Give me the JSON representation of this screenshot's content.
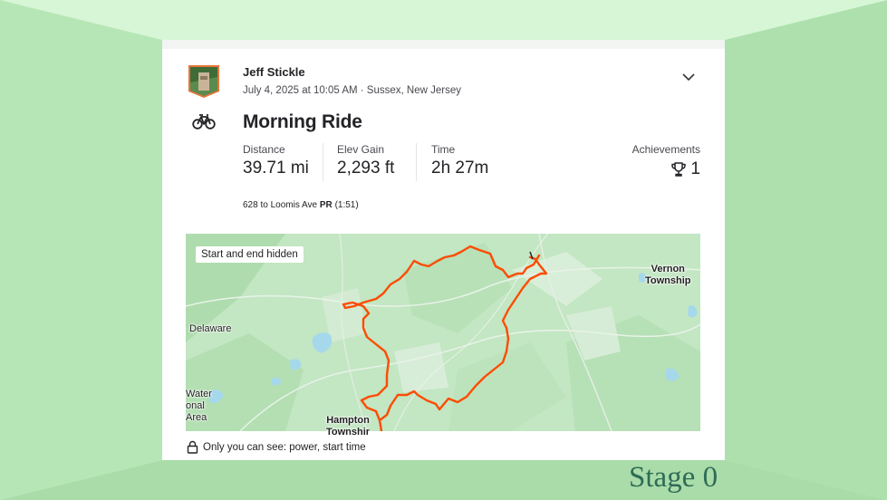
{
  "colors": {
    "stage_light": "#d3f2d3",
    "stage_mid": "#b6e6b6",
    "stage_dark": "#a9dca9",
    "route": "#fc4c02",
    "map_green": "#bfe3bf",
    "water": "#a6d8ec",
    "stage_text": "#2f6b56"
  },
  "activity": {
    "athlete_name": "Jeff Stickle",
    "meta": "July 4, 2025 at 10:05 AM · Sussex, New Jersey",
    "title": "Morning Ride",
    "sport_icon": "bike-icon",
    "stats": [
      {
        "label": "Distance",
        "value": "39.71 mi"
      },
      {
        "label": "Elev Gain",
        "value": "2,293 ft"
      },
      {
        "label": "Time",
        "value": "2h 27m"
      }
    ],
    "achievements": {
      "label": "Achievements",
      "count": "1",
      "icon": "trophy-icon"
    },
    "segment": {
      "name": "628 to Loomis Ave",
      "badge": "PR",
      "time": "(1:51)"
    },
    "menu_icon": "chevron-down-icon"
  },
  "map": {
    "badge": "Start and end hidden",
    "labels": {
      "vernon_1": "Vernon",
      "vernon_2": "Township",
      "delaware": "Delaware",
      "water_1": "Water",
      "water_2": "onal",
      "water_3": "Area",
      "hampton_1": "Hampton",
      "hampton_2": "Townshir"
    }
  },
  "privacy": {
    "icon": "lock-icon",
    "text": "Only you can see: power, start time"
  },
  "stage": {
    "label": "Stage 0"
  }
}
